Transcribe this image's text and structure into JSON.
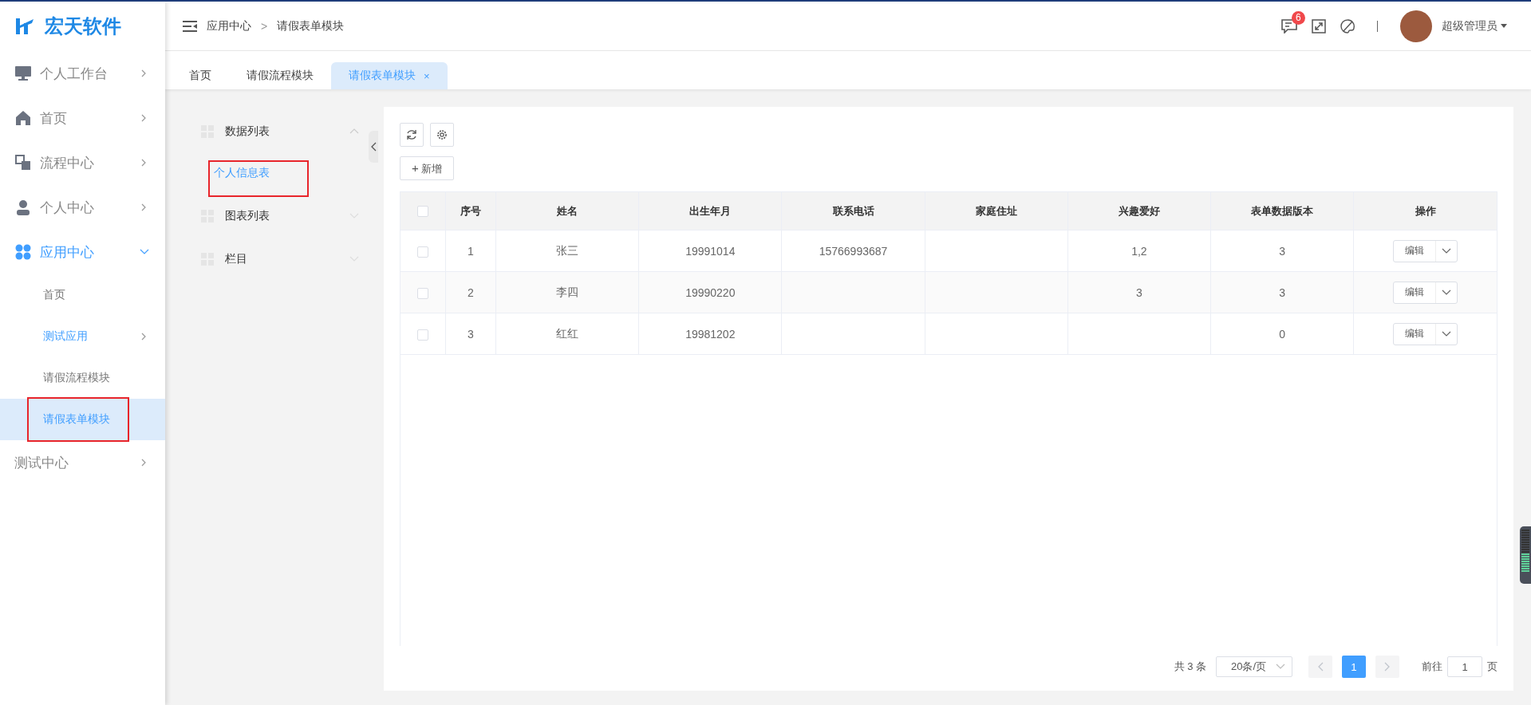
{
  "sidebar": {
    "logo_text": "宏天软件",
    "items": [
      {
        "label": "个人工作台",
        "expanded": false,
        "active": false
      },
      {
        "label": "首页",
        "expanded": false,
        "active": false
      },
      {
        "label": "流程中心",
        "expanded": false,
        "active": false
      },
      {
        "label": "个人中心",
        "expanded": false,
        "active": false
      },
      {
        "label": "应用中心",
        "expanded": true,
        "active": true,
        "children": [
          {
            "label": "首页",
            "has_children": false,
            "active": false,
            "selected": false,
            "highlighted": false
          },
          {
            "label": "测试应用",
            "has_children": true,
            "active": true,
            "selected": false,
            "highlighted": false
          },
          {
            "label": "请假流程模块",
            "has_children": false,
            "active": false,
            "selected": false,
            "highlighted": false
          },
          {
            "label": "请假表单模块",
            "has_children": false,
            "active": true,
            "selected": true,
            "highlighted": true
          }
        ]
      },
      {
        "label": "测试中心",
        "expanded": false,
        "active": false
      }
    ]
  },
  "header": {
    "breadcrumb": [
      "应用中心",
      "请假表单模块"
    ],
    "separator": ">",
    "notification_count": "6",
    "user_name": "超级管理员"
  },
  "tabs": [
    {
      "label": "首页",
      "selected": false,
      "closable": false
    },
    {
      "label": "请假流程模块",
      "selected": false,
      "closable": false
    },
    {
      "label": "请假表单模块",
      "selected": true,
      "closable": true,
      "close_glyph": "×"
    }
  ],
  "tree": [
    {
      "label": "数据列表",
      "expanded": true,
      "children": [
        {
          "label": "个人信息表",
          "selected": true,
          "highlighted": true
        }
      ]
    },
    {
      "label": "图表列表",
      "expanded": false
    },
    {
      "label": "栏目",
      "expanded": false
    }
  ],
  "toolbar": {
    "add_button": "新增",
    "add_glyph": "+"
  },
  "table": {
    "columns": [
      "序号",
      "姓名",
      "出生年月",
      "联系电话",
      "家庭住址",
      "兴趣爱好",
      "表单数据版本",
      "操作"
    ],
    "header_checked": false,
    "rows": [
      {
        "checked": false,
        "cells": [
          "1",
          "张三",
          "19991014",
          "15766993687",
          "",
          "1,2",
          "3"
        ],
        "action": "编辑"
      },
      {
        "checked": false,
        "cells": [
          "2",
          "李四",
          "19990220",
          "",
          "",
          "3",
          "3"
        ],
        "action": "编辑"
      },
      {
        "checked": false,
        "cells": [
          "3",
          "红红",
          "19981202",
          "",
          "",
          "",
          "0"
        ],
        "action": "编辑"
      }
    ]
  },
  "pagination": {
    "total": "共 3 条",
    "page_size": "20条/页",
    "pages": [
      {
        "label": "1",
        "selected": true
      }
    ],
    "goto_label": "前往",
    "goto_value": "1",
    "goto_suffix": "页"
  }
}
